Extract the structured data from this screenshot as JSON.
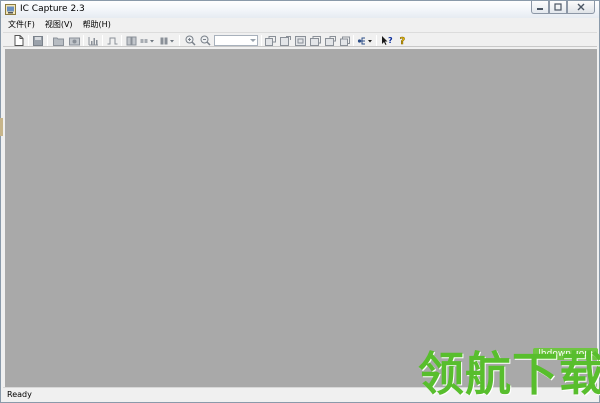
{
  "window": {
    "title": "IC Capture 2.3"
  },
  "menubar": {
    "items": [
      {
        "label": "文件(F)"
      },
      {
        "label": "视图(V)"
      },
      {
        "label": "帮助(H)"
      }
    ]
  },
  "toolbar": {
    "zoom_value": ""
  },
  "statusbar": {
    "text": "Ready"
  },
  "watermark": {
    "text": "领航下载",
    "url": "lhdown.com"
  },
  "colors": {
    "client_bg": "#a9a9a9",
    "watermark_green": "#58be2d"
  }
}
